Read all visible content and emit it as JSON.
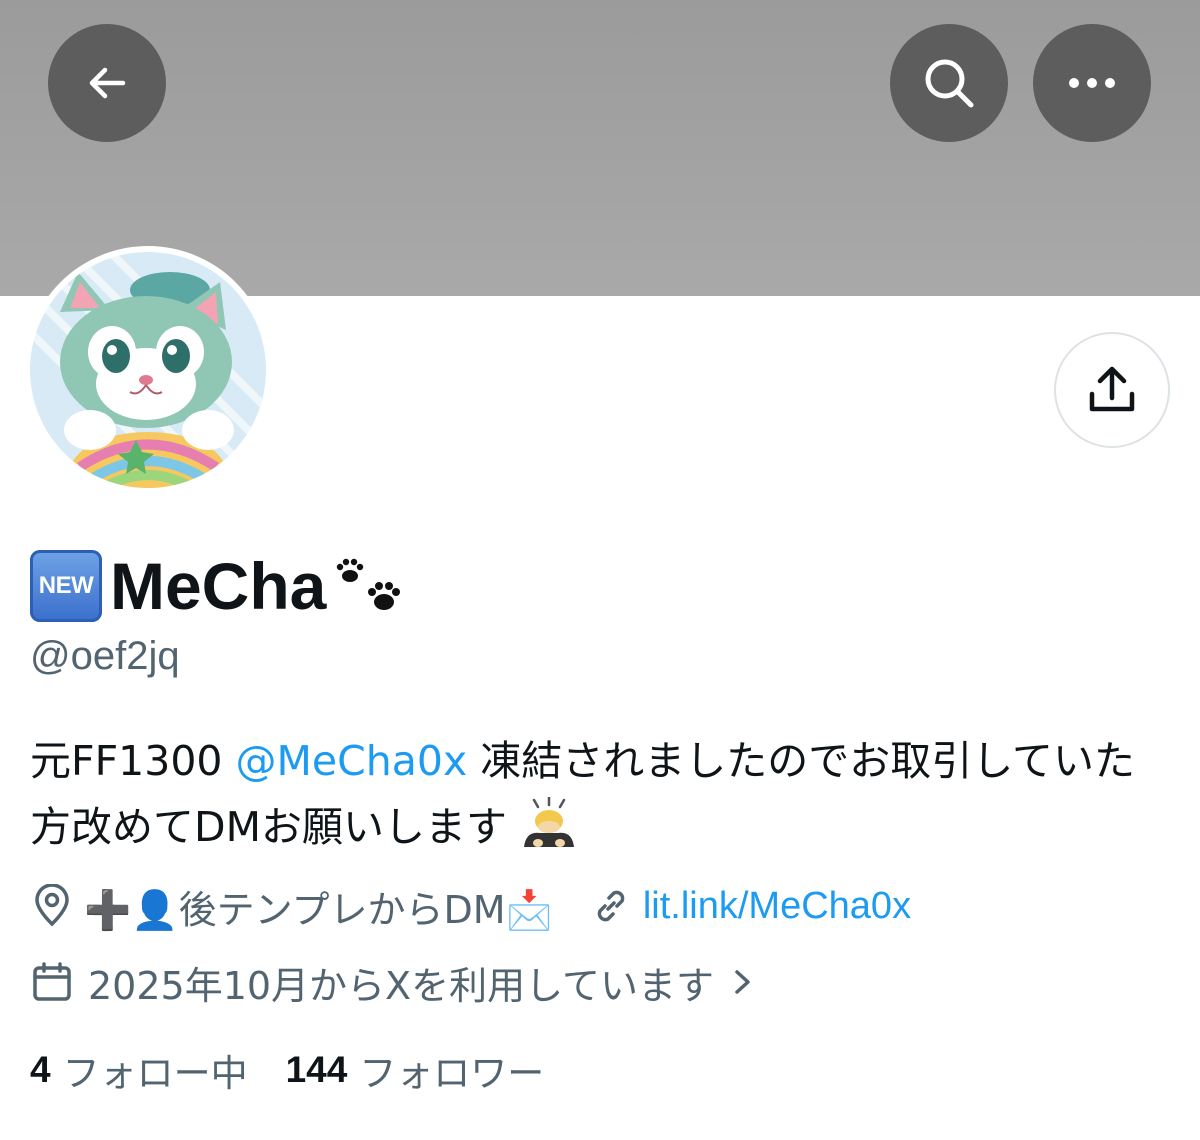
{
  "header": {
    "back_icon": "arrow-left-icon",
    "search_icon": "search-icon",
    "more_icon": "more-horizontal-icon",
    "share_icon": "share-icon"
  },
  "profile": {
    "name_badge": "NEW",
    "display_name": "MeCha",
    "name_emoji": "paw-prints",
    "handle": "@oef2jq",
    "bio": {
      "before": "元FF1300 ",
      "mention": "@MeCha0x",
      "after": " 凍結されましたのでお取引していた方改めてDMお願いします"
    },
    "location": "➕👤後テンプレからDM📩",
    "website": "lit.link/MeCha0x",
    "joined": "2025年10月からXを利用しています",
    "following_count": "4",
    "following_label": "フォロー中",
    "followers_count": "144",
    "followers_label": "フォロワー"
  },
  "colors": {
    "banner": "#a3a3a3",
    "link": "#1d9bf0",
    "secondary_text": "#536471",
    "primary_text": "#0f1419"
  }
}
